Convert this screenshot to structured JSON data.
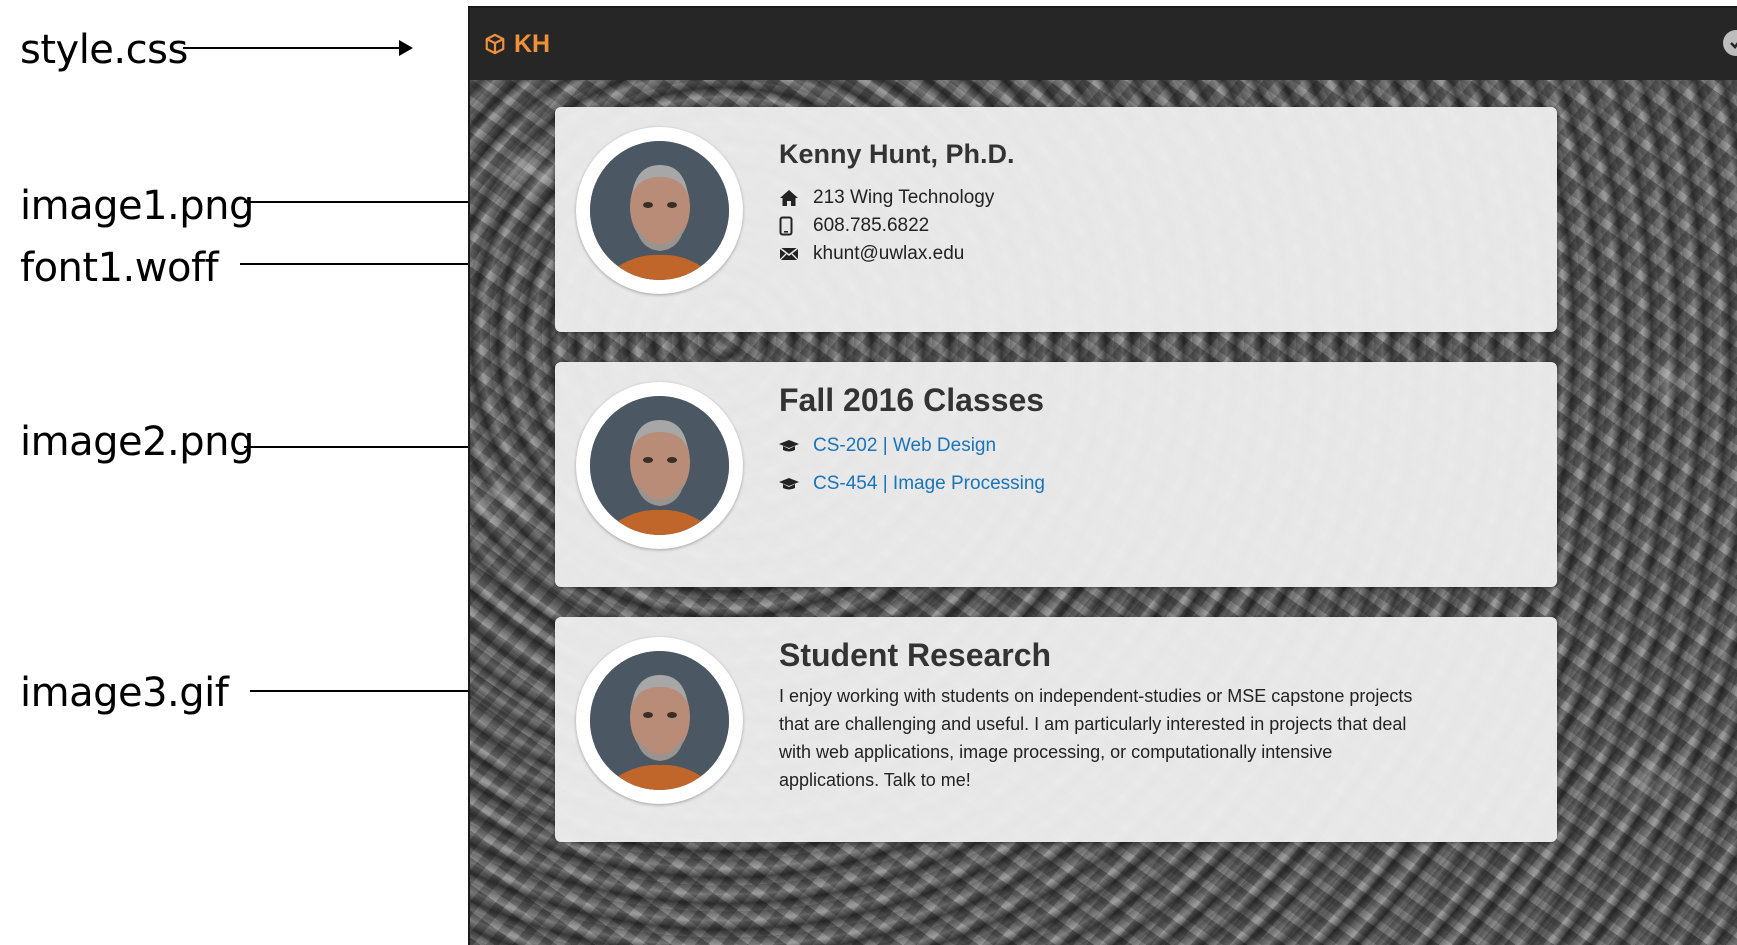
{
  "annotations": [
    {
      "label": "style.css"
    },
    {
      "label": "image1.png"
    },
    {
      "label": "font1.woff"
    },
    {
      "label": "image2.png"
    },
    {
      "label": "image3.gif"
    }
  ],
  "navbar": {
    "brand": "KH",
    "brand_color": "#f0913a",
    "brand_icon": "cube-icon",
    "right_icon": "check-circle-icon"
  },
  "cards": {
    "contact": {
      "name": "Kenny Hunt, Ph.D.",
      "address": "213 Wing Technology",
      "phone": "608.785.6822",
      "email": "khunt@uwlax.edu"
    },
    "classes": {
      "title": "Fall 2016 Classes",
      "items": [
        {
          "label": "CS-202 | Web Design"
        },
        {
          "label": "CS-454 | Image Processing"
        }
      ],
      "link_color": "#1a74b9"
    },
    "research": {
      "title": "Student Research",
      "text": "I enjoy working with students on independent-studies or MSE capstone projects that are challenging and useful. I am particularly interested in projects that deal with web applications, image processing, or computationally intensive applications. Talk to me!"
    }
  }
}
